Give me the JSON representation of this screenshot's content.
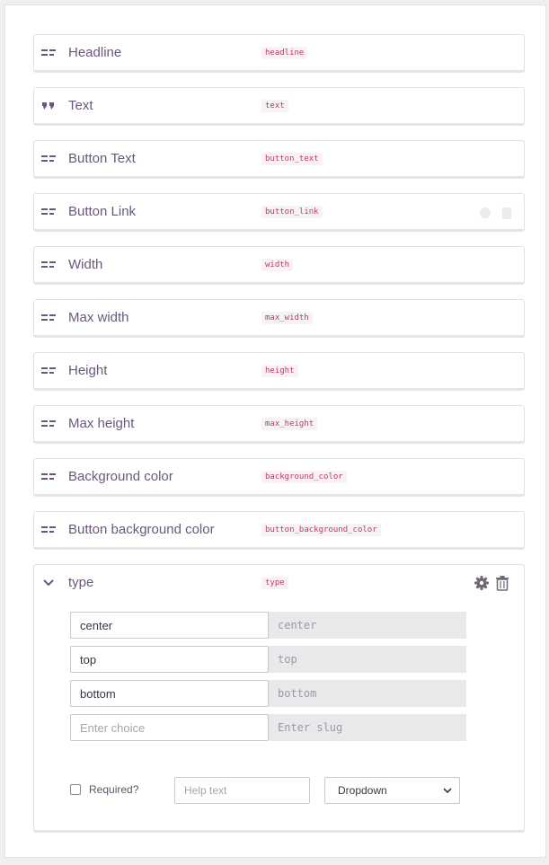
{
  "fields": [
    {
      "label": "Headline",
      "slug": "headline",
      "icon": "short-text-icon"
    },
    {
      "label": "Text",
      "slug": "text",
      "icon": "quote-icon"
    },
    {
      "label": "Button Text",
      "slug": "button_text",
      "icon": "short-text-icon"
    },
    {
      "label": "Button Link",
      "slug": "button_link",
      "icon": "short-text-icon"
    },
    {
      "label": "Width",
      "slug": "width",
      "icon": "short-text-icon"
    },
    {
      "label": "Max width",
      "slug": "max_width",
      "icon": "short-text-icon"
    },
    {
      "label": "Height",
      "slug": "height",
      "icon": "short-text-icon"
    },
    {
      "label": "Max height",
      "slug": "max_height",
      "icon": "short-text-icon"
    },
    {
      "label": "Background color",
      "slug": "background_color",
      "icon": "short-text-icon"
    },
    {
      "label": "Button background color",
      "slug": "button_background_color",
      "icon": "short-text-icon"
    }
  ],
  "expanded_field": {
    "label": "type",
    "slug": "type",
    "icon": "chevron-down-icon",
    "choices": [
      {
        "value": "center",
        "slug": "center"
      },
      {
        "value": "top",
        "slug": "top"
      },
      {
        "value": "bottom",
        "slug": "bottom"
      }
    ],
    "new_choice": {
      "placeholder": "Enter choice",
      "slug_placeholder": "Enter slug"
    },
    "required_label": "Required?",
    "help_placeholder": "Help text",
    "type_select_value": "Dropdown"
  },
  "colors": {
    "label": "#6a577e",
    "slug": "#c4365c",
    "icon": "#6a577e"
  }
}
